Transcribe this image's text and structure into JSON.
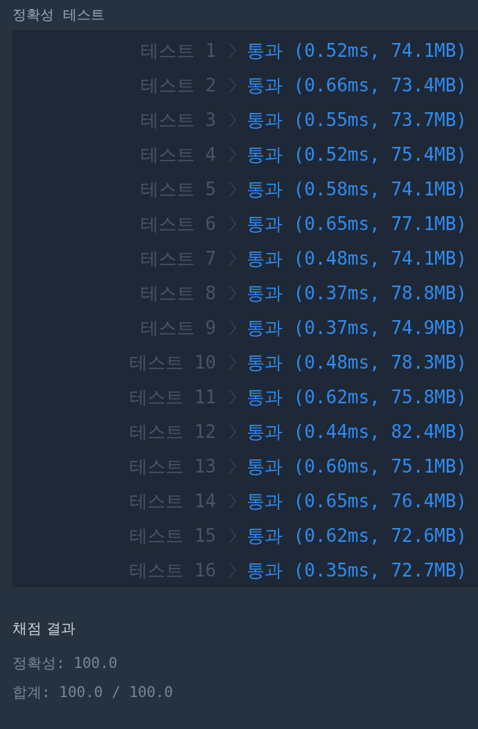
{
  "section_title": "정확성  테스트",
  "tests": [
    {
      "label": "테스트 1",
      "status": "통과",
      "detail": "(0.52ms, 74.1MB)"
    },
    {
      "label": "테스트 2",
      "status": "통과",
      "detail": "(0.66ms, 73.4MB)"
    },
    {
      "label": "테스트 3",
      "status": "통과",
      "detail": "(0.55ms, 73.7MB)"
    },
    {
      "label": "테스트 4",
      "status": "통과",
      "detail": "(0.52ms, 75.4MB)"
    },
    {
      "label": "테스트 5",
      "status": "통과",
      "detail": "(0.58ms, 74.1MB)"
    },
    {
      "label": "테스트 6",
      "status": "통과",
      "detail": "(0.65ms, 77.1MB)"
    },
    {
      "label": "테스트 7",
      "status": "통과",
      "detail": "(0.48ms, 74.1MB)"
    },
    {
      "label": "테스트 8",
      "status": "통과",
      "detail": "(0.37ms, 78.8MB)"
    },
    {
      "label": "테스트 9",
      "status": "통과",
      "detail": "(0.37ms, 74.9MB)"
    },
    {
      "label": "테스트 10",
      "status": "통과",
      "detail": "(0.48ms, 78.3MB)"
    },
    {
      "label": "테스트 11",
      "status": "통과",
      "detail": "(0.62ms, 75.8MB)"
    },
    {
      "label": "테스트 12",
      "status": "통과",
      "detail": "(0.44ms, 82.4MB)"
    },
    {
      "label": "테스트 13",
      "status": "통과",
      "detail": "(0.60ms, 75.1MB)"
    },
    {
      "label": "테스트 14",
      "status": "통과",
      "detail": "(0.65ms, 76.4MB)"
    },
    {
      "label": "테스트 15",
      "status": "통과",
      "detail": "(0.62ms, 72.6MB)"
    },
    {
      "label": "테스트 16",
      "status": "통과",
      "detail": "(0.35ms, 72.7MB)"
    }
  ],
  "result": {
    "title": "채점 결과",
    "lines": [
      "정확성: 100.0",
      "합계: 100.0 / 100.0"
    ]
  }
}
